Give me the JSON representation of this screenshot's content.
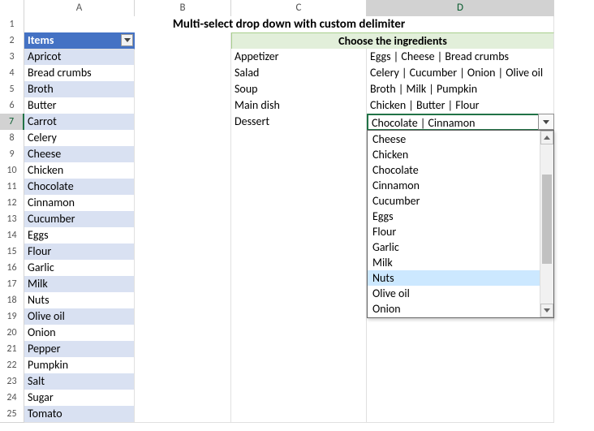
{
  "columns": [
    "A",
    "B",
    "C",
    "D"
  ],
  "title": "Multi-select drop down with custom delimiter",
  "items_header": "Items",
  "choose_header": "Choose the ingredients",
  "items": [
    "Apricot",
    "Bread crumbs",
    "Broth",
    "Butter",
    "Carrot",
    "Celery",
    "Cheese",
    "Chicken",
    "Chocolate",
    "Cinnamon",
    "Cucumber",
    "Eggs",
    "Flour",
    "Garlic",
    "Milk",
    "Nuts",
    "Olive oil",
    "Onion",
    "Pepper",
    "Pumpkin",
    "Salt",
    "Sugar",
    "Tomato"
  ],
  "recipes": [
    {
      "name": "Appetizer",
      "ing": "Eggs | Cheese | Bread crumbs"
    },
    {
      "name": "Salad",
      "ing": "Celery | Cucumber | Onion | Olive oil"
    },
    {
      "name": "Soup",
      "ing": "Broth | Milk | Pumpkin"
    },
    {
      "name": "Main dish",
      "ing": "Chicken | Butter | Flour"
    },
    {
      "name": "Dessert",
      "ing": "Chocolate | Cinnamon"
    }
  ],
  "dropdown": {
    "options": [
      "Cheese",
      "Chicken",
      "Chocolate",
      "Cinnamon",
      "Cucumber",
      "Eggs",
      "Flour",
      "Garlic",
      "Milk",
      "Nuts",
      "Olive oil",
      "Onion"
    ],
    "highlighted_index": 9
  },
  "selected_cell": "D7"
}
